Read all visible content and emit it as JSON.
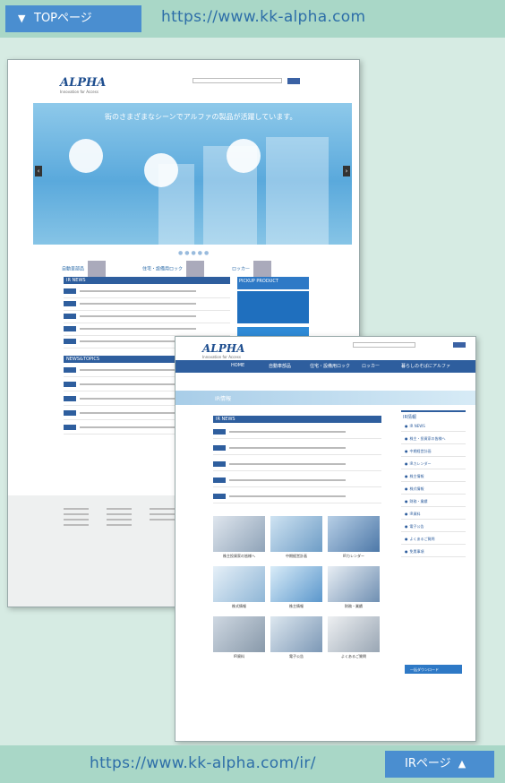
{
  "top_caption": {
    "label": "TOPページ",
    "arrow": "▼",
    "url": "https://www.kk-alpha.com"
  },
  "bottom_caption": {
    "label": "IRページ",
    "arrow": "▲",
    "url": "https://www.kk-alpha.com/ir/"
  },
  "top_page": {
    "logo": "ALPHA",
    "hero_headline": "街のさまざまなシーンでアルファの製品が活躍しています。",
    "products": [
      "自動車部品",
      "住宅・設備用ロック",
      "ロッカー"
    ],
    "ir_news_title": "IR NEWS",
    "news_topics_title": "NEWS&TOPICS",
    "pickup_title": "PICKUP PRODUCT"
  },
  "ir_page": {
    "logo": "ALPHA",
    "nav": [
      "HOME",
      "自動車部品",
      "住宅・設備用ロック",
      "ロッカー",
      "暮らしのそばにアルファ"
    ],
    "page_title": "IR情報",
    "ir_news_title": "IR NEWS",
    "side_head": "IR情報",
    "side_items": [
      "IR NEWS",
      "株主・投資家の皆様へ",
      "中期経営計画",
      "IRカレンダー",
      "株主情報",
      "株式情報",
      "財務・業績",
      "IR資料",
      "電子公告",
      "よくあるご質問",
      "免責事項"
    ],
    "download_label": "一括ダウンロード",
    "tiles": [
      "株主投資家の皆様へ",
      "中期経営計画",
      "IRカレンダー",
      "株式情報",
      "株主情報",
      "財務・業績",
      "IR資料",
      "電子公告",
      "よくあるご質問"
    ]
  },
  "colors": {
    "caption_bg": "#a9d7c7",
    "tag_bg": "#4a8ed0",
    "url_text": "#2d6ea8",
    "nav_blue": "#2e5e9e",
    "page_bg": "#d6ebe3"
  }
}
